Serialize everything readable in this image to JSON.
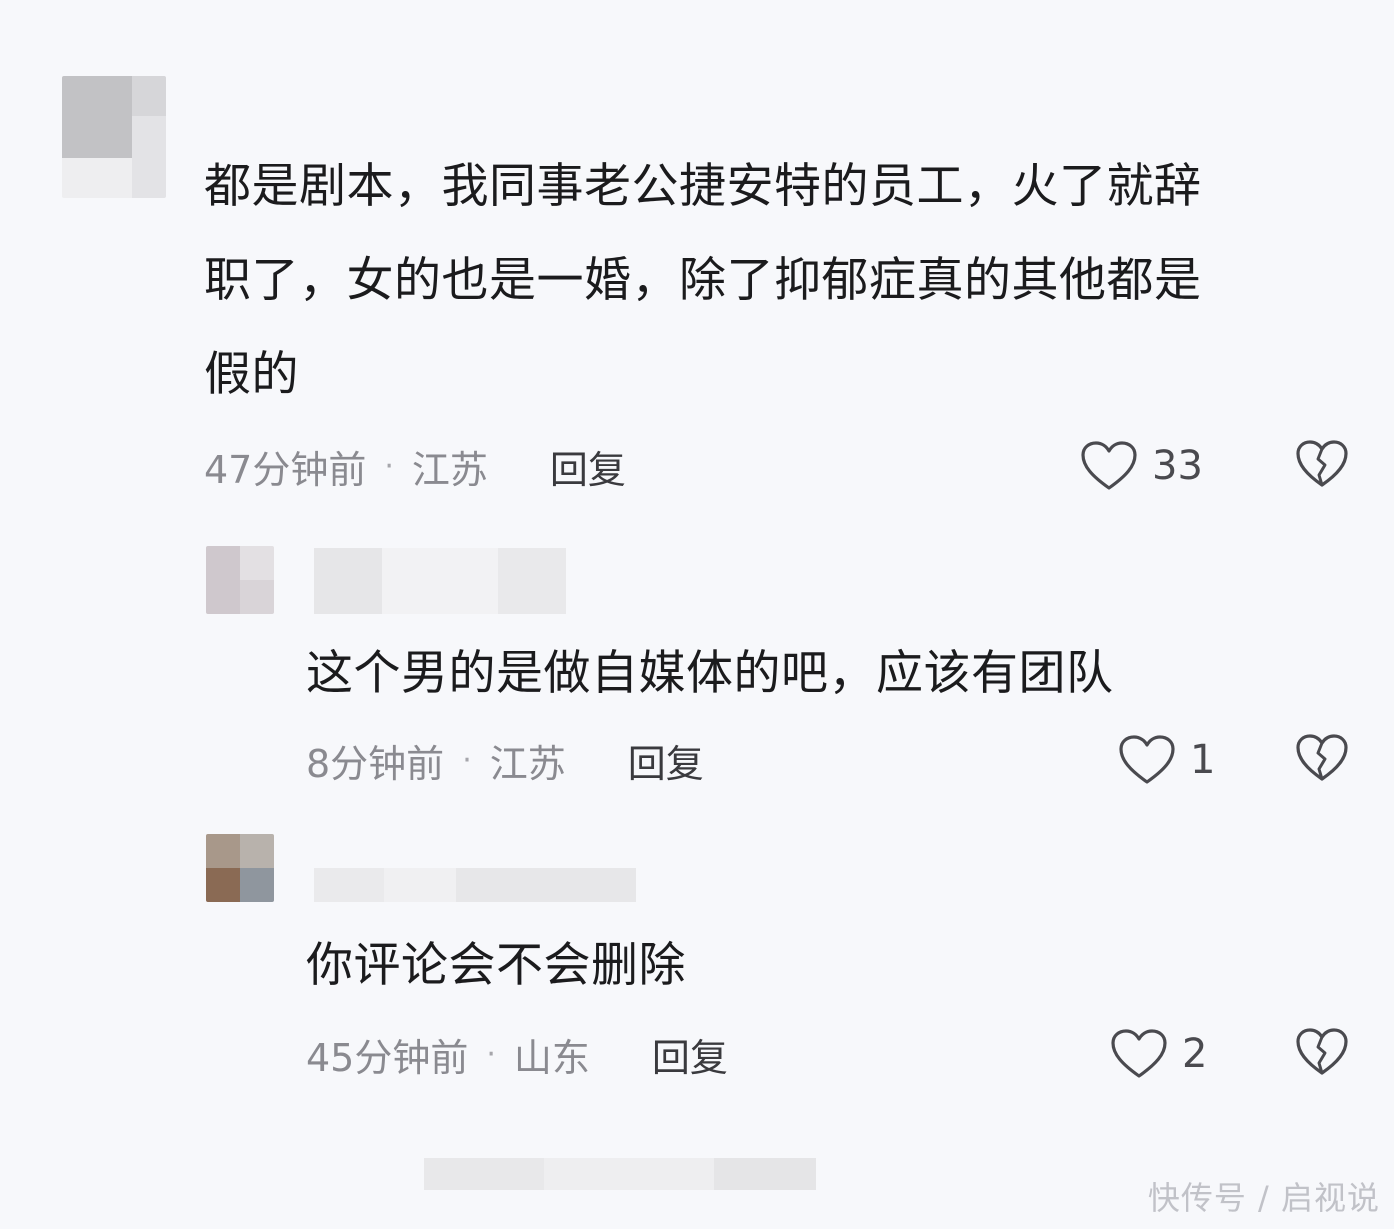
{
  "comments": [
    {
      "text_lines": [
        "都是剧本，我同事老公捷安特的员工，火了就辞",
        "职了，女的也是一婚，除了抑郁症真的其他都是",
        "假的"
      ],
      "time": "47分钟前",
      "separator": "·",
      "location": "江苏",
      "reply_label": "回复",
      "likes": "33"
    },
    {
      "text": "这个男的是做自媒体的吧，应该有团队",
      "time": "8分钟前",
      "separator": "·",
      "location": "江苏",
      "reply_label": "回复",
      "likes": "1"
    },
    {
      "text": "你评论会不会删除",
      "time": "45分钟前",
      "separator": "·",
      "location": "山东",
      "reply_label": "回复",
      "likes": "2"
    }
  ],
  "watermark": "快传号 / 启视说",
  "icons": {
    "like": "heart-outline-icon",
    "dislike": "broken-heart-icon"
  },
  "colors": {
    "background": "#f7f8fb",
    "text": "#1b1b1d",
    "meta": "#8a8a90",
    "icon_stroke": "#4a4a4f"
  }
}
